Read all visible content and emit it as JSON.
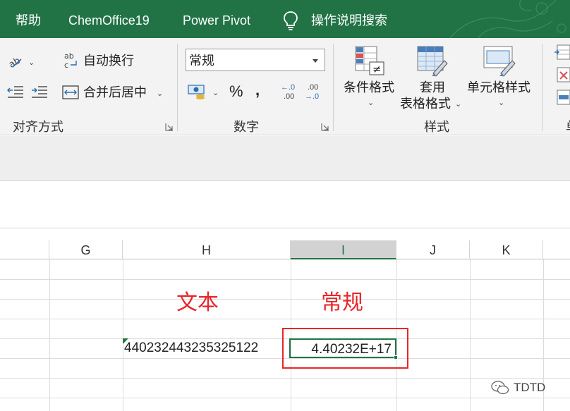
{
  "tabs": {
    "help": "帮助",
    "chemoffice": "ChemOffice19",
    "power_pivot": "Power Pivot",
    "tell_me": "操作说明搜索"
  },
  "ribbon": {
    "alignment": {
      "wrap_text": "自动换行",
      "merge_center": "合并后居中",
      "group_label": "对齐方式"
    },
    "number": {
      "format_value": "常规",
      "percent": "%",
      "comma": ",",
      "increase_decimal_top": "←.0",
      "increase_decimal_bottom": ".00",
      "decrease_decimal_top": ".00",
      "decrease_decimal_bottom": "→.0",
      "group_label": "数字"
    },
    "styles": {
      "conditional_formatting": "条件格式",
      "format_as_table_line1": "套用",
      "format_as_table_line2": "表格格式",
      "cell_styles": "单元格样式",
      "group_label": "样式"
    },
    "cells": {
      "group_label_partial": "单"
    }
  },
  "sheet": {
    "columns": [
      "G",
      "H",
      "I",
      "J",
      "K"
    ],
    "selected_column": "I",
    "annotation_text": "文本",
    "annotation_general": "常规",
    "cell_h_value": "440232443235325122",
    "cell_i_value": "4.40232E+17"
  },
  "watermark": {
    "text": "TDTD"
  },
  "colors": {
    "excel_green": "#217346",
    "annotation_red": "#e8262a"
  }
}
